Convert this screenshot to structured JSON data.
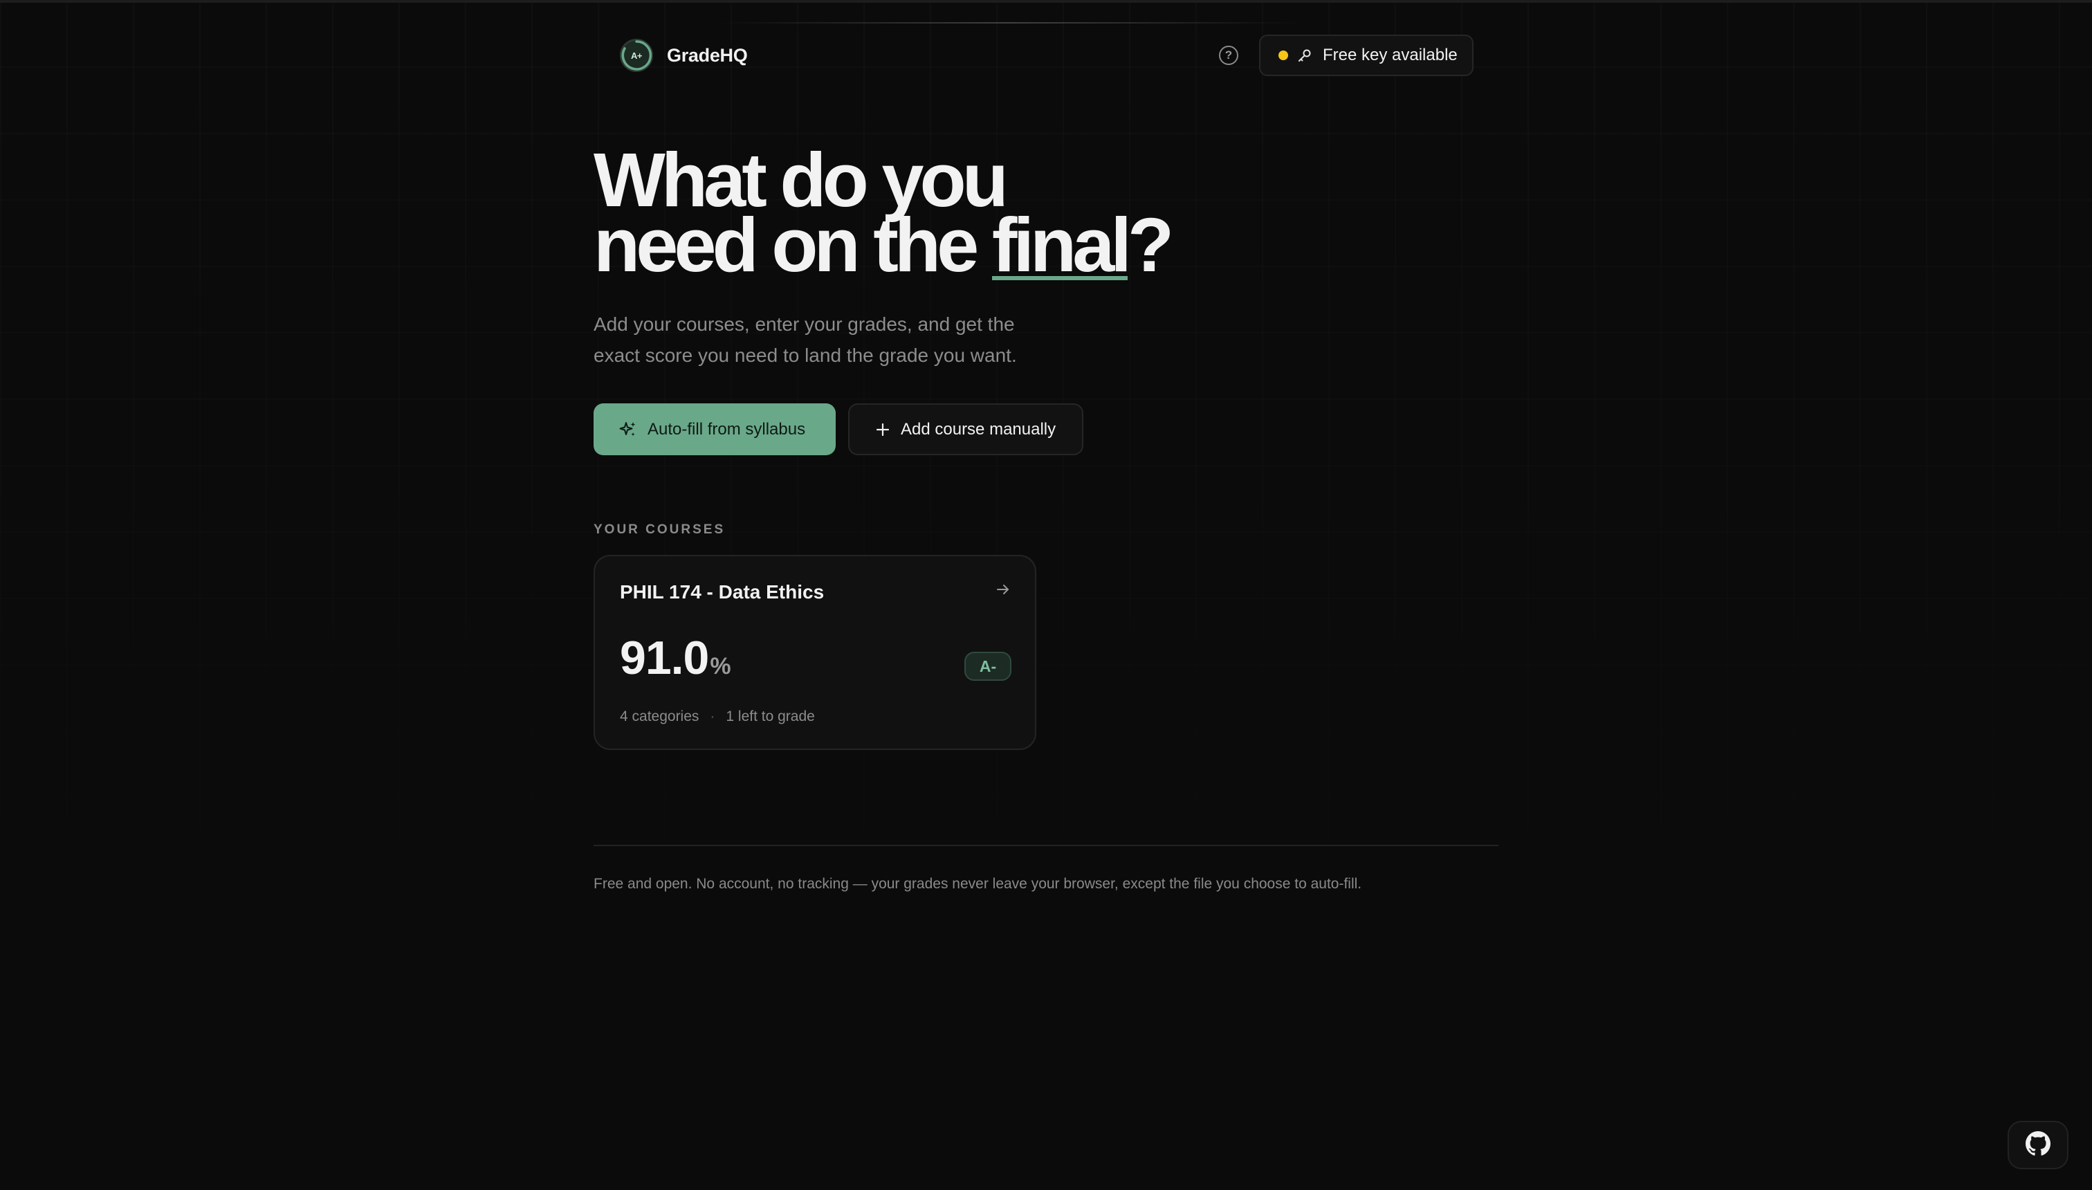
{
  "header": {
    "logo_text": "A+",
    "brand_name": "GradeHQ",
    "help_icon": "question-circle-icon",
    "key_status": {
      "label": "Free key available",
      "dot_color": "#f5c518",
      "icon": "key-icon"
    }
  },
  "hero": {
    "title_line1": "What do you",
    "title_line2_prefix": "need on the ",
    "title_highlight": "final",
    "title_suffix": "?",
    "subtitle_line1": "Add your courses, enter your grades, and get the",
    "subtitle_line2": "exact score you need to land the grade you want.",
    "primary_button": {
      "label": "Auto-fill from syllabus",
      "icon": "sparkles-icon"
    },
    "secondary_button": {
      "label": "Add course manually",
      "icon": "plus-icon"
    }
  },
  "courses": {
    "section_label": "YOUR COURSES",
    "items": [
      {
        "title": "PHIL 174 - Data Ethics",
        "percent": "91.0",
        "percent_sign": "%",
        "grade": "A-",
        "categories": "4 categories",
        "separator": "·",
        "remaining": "1 left to grade"
      }
    ]
  },
  "footer": {
    "text": "Free and open. No account, no tracking — your grades never leave your browser, except the file you choose to auto-fill."
  },
  "colors": {
    "accent": "#6aa88a",
    "background": "#0b0b0b",
    "status_yellow": "#f5c518"
  },
  "github_icon": "github-icon"
}
